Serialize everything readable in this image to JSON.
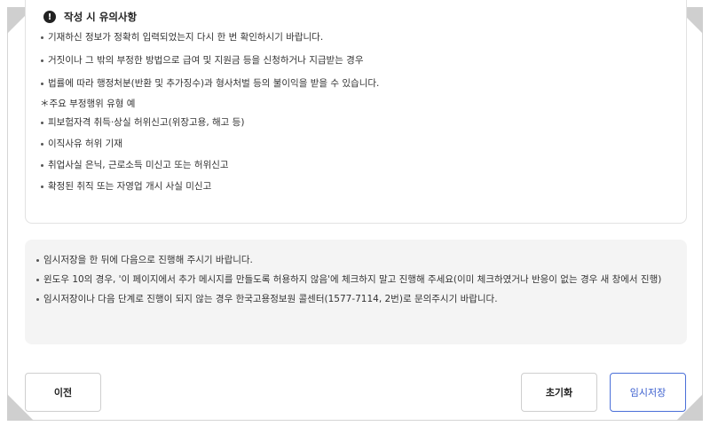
{
  "notice": {
    "title": "작성 시 유의사항",
    "icon": "alert-icon",
    "items": [
      "기재하신 정보가 정확히 입력되었는지 다시 한 번 확인하시기 바랍니다.",
      "거짓이나 그 밖의 부정한 방법으로 급여 및 지원금 등을 신청하거나 지급받는 경우",
      "법률에 따라 행정처분(반환 및 추가징수)과 형사처벌 등의 불이익을 받을 수 있습니다."
    ],
    "examples_heading": "＊주요 부정행위 유형 예",
    "examples": [
      "피보험자격 취득·상실 허위신고(위장고용, 해고 등)",
      "이직사유 허위 기재",
      "취업사실 은닉, 근로소득 미신고 또는 허위신고",
      "확정된 취직 또는 자영업 개시 사실 미신고"
    ]
  },
  "info": {
    "items": [
      "임시저장을 한 뒤에 다음으로 진행해 주시기 바랍니다.",
      "윈도우 10의 경우, '이 페이지에서 추가 메시지를 만들도록 허용하지 않음'에 체크하지 말고 진행해 주세요(이미 체크하였거나 반응이 없는 경우 새 창에서 진행)",
      "임시저장이나 다음 단계로 진행이 되지 않는 경우 한국고용정보원 콜센터(1577-7114, 2번)로 문의주시기 바랍니다."
    ]
  },
  "buttons": {
    "prev": "이전",
    "reset": "초기화",
    "save": "임시저장"
  },
  "colors": {
    "accent": "#3b5fcf",
    "info_bg": "#f4f4f4"
  }
}
